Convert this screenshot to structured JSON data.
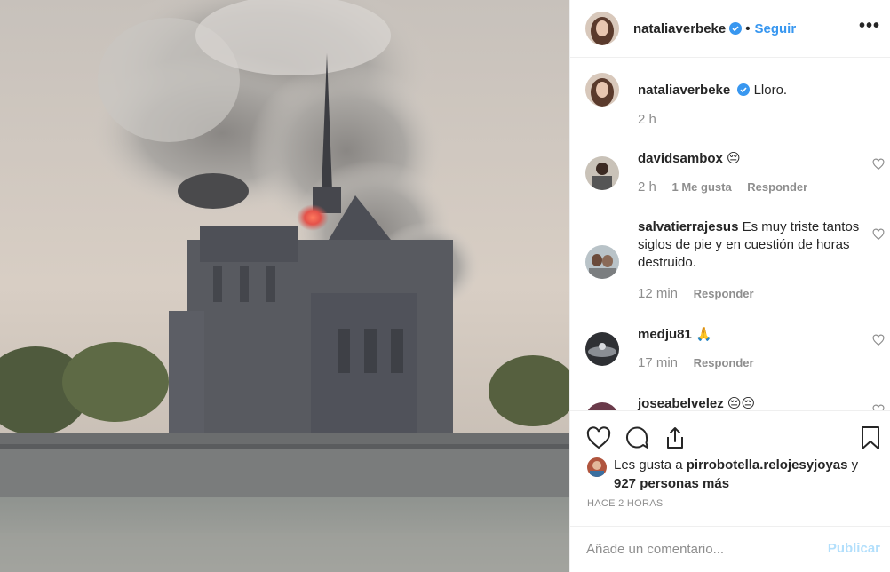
{
  "post": {
    "author": "nataliaverbeke",
    "follow_label": "Seguir",
    "dot": "•",
    "more_label": "•••"
  },
  "comments": [
    {
      "user": "nataliaverbeke",
      "text": "Lloro.",
      "time": "2 h",
      "likes": "",
      "reply": ""
    },
    {
      "user": "davidsambox",
      "text": "😔",
      "time": "2 h",
      "likes": "1 Me gusta",
      "reply": "Responder"
    },
    {
      "user": "salvatierrajesus",
      "text": "Es muy triste tantos siglos de pie y en cuestión de horas destruido.",
      "time": "12 min",
      "likes": "",
      "reply": "Responder"
    },
    {
      "user": "medju81",
      "text": "🙏",
      "time": "17 min",
      "likes": "",
      "reply": "Responder"
    },
    {
      "user": "joseabelvelez",
      "text": "😔😔",
      "time": "",
      "likes": "",
      "reply": ""
    }
  ],
  "likes": {
    "prefix": "Les gusta a",
    "first_user": "pirrobotella.relojesyjoyas",
    "middle": "y",
    "count_text": "927 personas más"
  },
  "time_ago": "HACE 2 HORAS",
  "comment_box": {
    "placeholder": "Añade un comentario...",
    "publish_label": "Publicar"
  },
  "icons": {
    "like": "heart-outline-icon",
    "comment": "speech-bubble-icon",
    "share": "share-icon",
    "save": "bookmark-icon",
    "verified": "verified-badge-icon"
  },
  "colors": {
    "link_blue": "#3897f0",
    "publish_disabled": "#b2dffc",
    "muted": "#8e8e8e",
    "text": "#262626",
    "border": "#efefef"
  }
}
